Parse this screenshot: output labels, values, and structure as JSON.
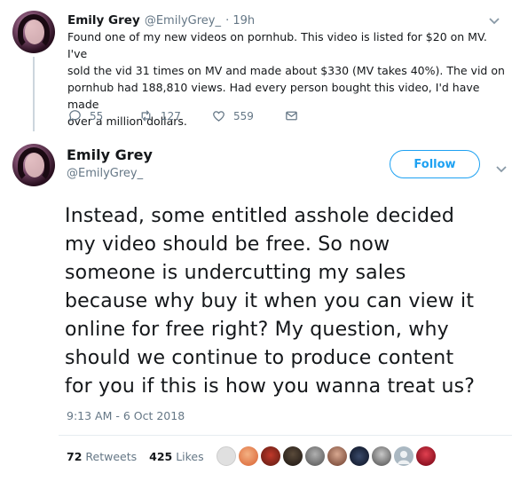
{
  "parent_tweet": {
    "author_name": "Emily Grey",
    "author_handle": "@EmilyGrey_",
    "time": "· 19h",
    "lines": [
      "Found one of my new videos on pornhub. This video is listed for $20 on MV. I've",
      "sold the vid 31 times on MV and made about $330 (MV takes 40%). The vid on",
      "pornhub had 188,810 views. Had every person bought this video, I'd have made",
      "over a million dollars."
    ],
    "reply_count": "55",
    "retweet_count": "127",
    "like_count": "559"
  },
  "main_tweet": {
    "author_name": "Emily Grey",
    "author_handle": "@EmilyGrey_",
    "follow_label": "Follow",
    "lines": [
      "Instead, some entitled asshole decided",
      "my video should be free. So now",
      "someone is undercutting my sales",
      "because why buy it when you can view it",
      "online for free right? My question, why",
      "should we continue to produce content",
      "for you if this is how you wanna treat us?"
    ],
    "timestamp": "9:13 AM - 6 Oct 2018",
    "retweets_count": "72",
    "retweets_label": "Retweets",
    "likes_count": "425",
    "likes_label": "Likes"
  },
  "colors": {
    "accent": "#1da1f2",
    "muted": "#657786",
    "text": "#14171a",
    "border": "#e6ecf0"
  },
  "liker_avatar_icons": [
    "liker-avatar",
    "liker-avatar",
    "liker-avatar",
    "liker-avatar",
    "liker-avatar",
    "liker-avatar",
    "liker-avatar",
    "liker-avatar",
    "liker-avatar",
    "liker-avatar"
  ]
}
